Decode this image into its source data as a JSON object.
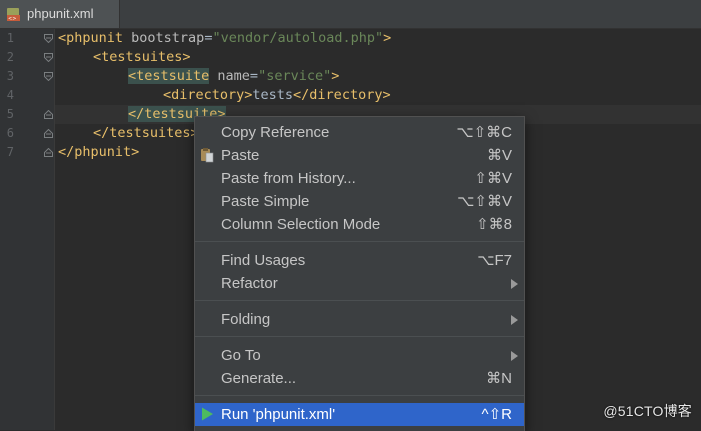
{
  "tab": {
    "title": "phpunit.xml",
    "icon": "xml-file-icon"
  },
  "line_numbers": [
    "1",
    "2",
    "3",
    "4",
    "5",
    "6",
    "7"
  ],
  "code": {
    "l1": {
      "tag_open": "<phpunit",
      "attr": " bootstrap",
      "eq": "=",
      "value": "\"vendor/autoload.php\"",
      "close": ">"
    },
    "l2": {
      "tag": "<testsuites>"
    },
    "l3": {
      "tag_open": "<testsuite",
      "attr": " name",
      "eq": "=",
      "value": "\"service\"",
      "close": ">"
    },
    "l4": {
      "open": "<directory>",
      "text": "tests",
      "close": "</directory>"
    },
    "l5": {
      "tag": "</testsuite>"
    },
    "l6": {
      "tag": "</testsuites>"
    },
    "l7": {
      "tag": "</phpunit>"
    }
  },
  "context_menu": {
    "items": [
      {
        "label": "Copy Reference",
        "shortcut": "⌥⇧⌘C"
      },
      {
        "label": "Paste",
        "shortcut": "⌘V",
        "icon": "clipboard-paste-icon"
      },
      {
        "label": "Paste from History...",
        "shortcut": "⇧⌘V"
      },
      {
        "label": "Paste Simple",
        "shortcut": "⌥⇧⌘V"
      },
      {
        "label": "Column Selection Mode",
        "shortcut": "⇧⌘8"
      },
      {
        "label": "Find Usages",
        "shortcut": "⌥F7"
      },
      {
        "label": "Refactor",
        "submenu": true
      },
      {
        "label": "Folding",
        "submenu": true
      },
      {
        "label": "Go To",
        "submenu": true
      },
      {
        "label": "Generate...",
        "shortcut": "⌘N"
      },
      {
        "label": "Run 'phpunit.xml'",
        "shortcut": "^⇧R",
        "icon": "run-play-icon",
        "selected": true
      }
    ]
  },
  "watermark": "@51CTO博客",
  "colors": {
    "editor_bg": "#2b2b2b",
    "tag": "#e8bf6a",
    "string": "#6a8759",
    "menu_bg": "#3c3f41",
    "selection": "#2f65ca",
    "run_icon": "#4dbb5f"
  }
}
